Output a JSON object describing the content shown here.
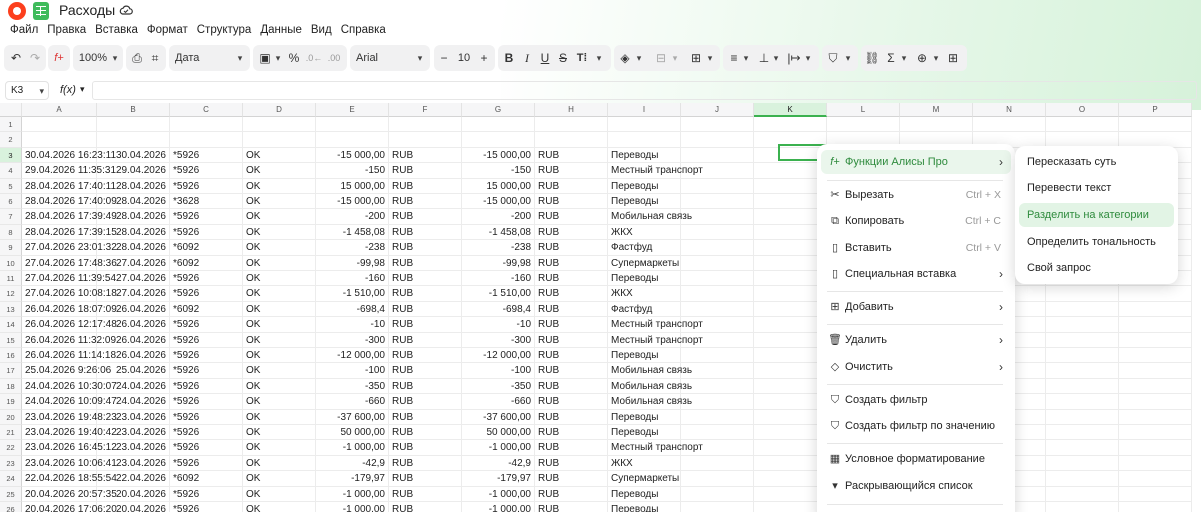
{
  "title": "Расходы",
  "menu": [
    "Файл",
    "Правка",
    "Вставка",
    "Формат",
    "Структура",
    "Данные",
    "Вид",
    "Справка"
  ],
  "toolbar": {
    "zoom": "100%",
    "format": "Дата",
    "font": "Arial",
    "size": "10",
    "minus": "−",
    "plus": "+",
    "bold": "B",
    "italic": "I",
    "underline": "U",
    "strike": "S",
    "percent": "%"
  },
  "cell_ref": "K3",
  "fx_label": "f(x)",
  "columns": [
    "A",
    "B",
    "C",
    "D",
    "E",
    "F",
    "G",
    "H",
    "I",
    "J",
    "K",
    "L",
    "M",
    "N",
    "O",
    "P"
  ],
  "selected_column": "K",
  "selected_row": "3",
  "rows": [
    {
      "n": "1",
      "a": "",
      "b": "",
      "c": "",
      "d": "",
      "e": "",
      "f": "",
      "g": "",
      "h": "",
      "i": ""
    },
    {
      "n": "2",
      "a": "",
      "b": "",
      "c": "",
      "d": "",
      "e": "",
      "f": "",
      "g": "",
      "h": "",
      "i": ""
    },
    {
      "n": "3",
      "a": "30.04.2026 16:23:11",
      "b": "30.04.2026",
      "c": "*5926",
      "d": "OK",
      "e": "-15 000,00",
      "f": "RUB",
      "g": "-15 000,00",
      "h": "RUB",
      "i": "Переводы"
    },
    {
      "n": "4",
      "a": "29.04.2026 11:35:31",
      "b": "29.04.2026",
      "c": "*5926",
      "d": "OK",
      "e": "-150",
      "f": "RUB",
      "g": "-150",
      "h": "RUB",
      "i": "Местный транспорт"
    },
    {
      "n": "5",
      "a": "28.04.2026 17:40:11",
      "b": "28.04.2026",
      "c": "*5926",
      "d": "OK",
      "e": "15 000,00",
      "f": "RUB",
      "g": "15 000,00",
      "h": "RUB",
      "i": "Переводы"
    },
    {
      "n": "6",
      "a": "28.04.2026 17:40:09",
      "b": "28.04.2026",
      "c": "*3628",
      "d": "OK",
      "e": "-15 000,00",
      "f": "RUB",
      "g": "-15 000,00",
      "h": "RUB",
      "i": "Переводы"
    },
    {
      "n": "7",
      "a": "28.04.2026 17:39:49",
      "b": "28.04.2026",
      "c": "*5926",
      "d": "OK",
      "e": "-200",
      "f": "RUB",
      "g": "-200",
      "h": "RUB",
      "i": "Мобильная связь"
    },
    {
      "n": "8",
      "a": "28.04.2026 17:39:15",
      "b": "28.04.2026",
      "c": "*5926",
      "d": "OK",
      "e": "-1 458,08",
      "f": "RUB",
      "g": "-1 458,08",
      "h": "RUB",
      "i": "ЖКХ"
    },
    {
      "n": "9",
      "a": "27.04.2026 23:01:32",
      "b": "28.04.2026",
      "c": "*6092",
      "d": "OK",
      "e": "-238",
      "f": "RUB",
      "g": "-238",
      "h": "RUB",
      "i": "Фастфуд"
    },
    {
      "n": "10",
      "a": "27.04.2026 17:48:36",
      "b": "27.04.2026",
      "c": "*6092",
      "d": "OK",
      "e": "-99,98",
      "f": "RUB",
      "g": "-99,98",
      "h": "RUB",
      "i": "Супермаркеты"
    },
    {
      "n": "11",
      "a": "27.04.2026 11:39:54",
      "b": "27.04.2026",
      "c": "*5926",
      "d": "OK",
      "e": "-160",
      "f": "RUB",
      "g": "-160",
      "h": "RUB",
      "i": "Переводы"
    },
    {
      "n": "12",
      "a": "27.04.2026 10:08:18",
      "b": "27.04.2026",
      "c": "*5926",
      "d": "OK",
      "e": "-1 510,00",
      "f": "RUB",
      "g": "-1 510,00",
      "h": "RUB",
      "i": "ЖКХ"
    },
    {
      "n": "13",
      "a": "26.04.2026 18:07:09",
      "b": "26.04.2026",
      "c": "*6092",
      "d": "OK",
      "e": "-698,4",
      "f": "RUB",
      "g": "-698,4",
      "h": "RUB",
      "i": "Фастфуд"
    },
    {
      "n": "14",
      "a": "26.04.2026 12:17:48",
      "b": "26.04.2026",
      "c": "*5926",
      "d": "OK",
      "e": "-10",
      "f": "RUB",
      "g": "-10",
      "h": "RUB",
      "i": "Местный транспорт"
    },
    {
      "n": "15",
      "a": "26.04.2026 11:32:09",
      "b": "26.04.2026",
      "c": "*5926",
      "d": "OK",
      "e": "-300",
      "f": "RUB",
      "g": "-300",
      "h": "RUB",
      "i": "Местный транспорт"
    },
    {
      "n": "16",
      "a": "26.04.2026 11:14:18",
      "b": "26.04.2026",
      "c": "*5926",
      "d": "OK",
      "e": "-12 000,00",
      "f": "RUB",
      "g": "-12 000,00",
      "h": "RUB",
      "i": "Переводы"
    },
    {
      "n": "17",
      "a": "25.04.2026 9:26:06",
      "b": "25.04.2026",
      "c": "*5926",
      "d": "OK",
      "e": "-100",
      "f": "RUB",
      "g": "-100",
      "h": "RUB",
      "i": "Мобильная связь"
    },
    {
      "n": "18",
      "a": "24.04.2026 10:30:07",
      "b": "24.04.2026",
      "c": "*5926",
      "d": "OK",
      "e": "-350",
      "f": "RUB",
      "g": "-350",
      "h": "RUB",
      "i": "Мобильная связь"
    },
    {
      "n": "19",
      "a": "24.04.2026 10:09:47",
      "b": "24.04.2026",
      "c": "*5926",
      "d": "OK",
      "e": "-660",
      "f": "RUB",
      "g": "-660",
      "h": "RUB",
      "i": "Мобильная связь"
    },
    {
      "n": "20",
      "a": "23.04.2026 19:48:23",
      "b": "23.04.2026",
      "c": "*5926",
      "d": "OK",
      "e": "-37 600,00",
      "f": "RUB",
      "g": "-37 600,00",
      "h": "RUB",
      "i": "Переводы"
    },
    {
      "n": "21",
      "a": "23.04.2026 19:40:42",
      "b": "23.04.2026",
      "c": "*5926",
      "d": "OK",
      "e": "50 000,00",
      "f": "RUB",
      "g": "50 000,00",
      "h": "RUB",
      "i": "Переводы"
    },
    {
      "n": "22",
      "a": "23.04.2026 16:45:12",
      "b": "23.04.2026",
      "c": "*5926",
      "d": "OK",
      "e": "-1 000,00",
      "f": "RUB",
      "g": "-1 000,00",
      "h": "RUB",
      "i": "Местный транспорт"
    },
    {
      "n": "23",
      "a": "23.04.2026 10:06:41",
      "b": "23.04.2026",
      "c": "*5926",
      "d": "OK",
      "e": "-42,9",
      "f": "RUB",
      "g": "-42,9",
      "h": "RUB",
      "i": "ЖКХ"
    },
    {
      "n": "24",
      "a": "22.04.2026 18:55:54",
      "b": "22.04.2026",
      "c": "*6092",
      "d": "OK",
      "e": "-179,97",
      "f": "RUB",
      "g": "-179,97",
      "h": "RUB",
      "i": "Супермаркеты"
    },
    {
      "n": "25",
      "a": "20.04.2026 20:57:35",
      "b": "20.04.2026",
      "c": "*5926",
      "d": "OK",
      "e": "-1 000,00",
      "f": "RUB",
      "g": "-1 000,00",
      "h": "RUB",
      "i": "Переводы"
    },
    {
      "n": "26",
      "a": "20.04.2026 17:06:20",
      "b": "20.04.2026",
      "c": "*5926",
      "d": "OK",
      "e": "-1 000,00",
      "f": "RUB",
      "g": "-1 000,00",
      "h": "RUB",
      "i": "Переводы"
    }
  ],
  "context_menu": {
    "alice": "Функции Алисы Про",
    "cut": "Вырезать",
    "cut_sc": "Ctrl + X",
    "copy": "Копировать",
    "copy_sc": "Ctrl + C",
    "paste": "Вставить",
    "paste_sc": "Ctrl + V",
    "paste_special": "Специальная вставка",
    "add": "Добавить",
    "delete": "Удалить",
    "clear": "Очистить",
    "filter": "Создать фильтр",
    "filter_value": "Создать фильтр по значению",
    "cond_format": "Условное форматирование",
    "dropdown": "Раскрывающийся список"
  },
  "submenu": [
    "Пересказать суть",
    "Перевести текст",
    "Разделить на категории",
    "Определить тональность",
    "Свой запрос"
  ],
  "submenu_highlighted": "Разделить на категории",
  "accent_color": "#3bb14f"
}
